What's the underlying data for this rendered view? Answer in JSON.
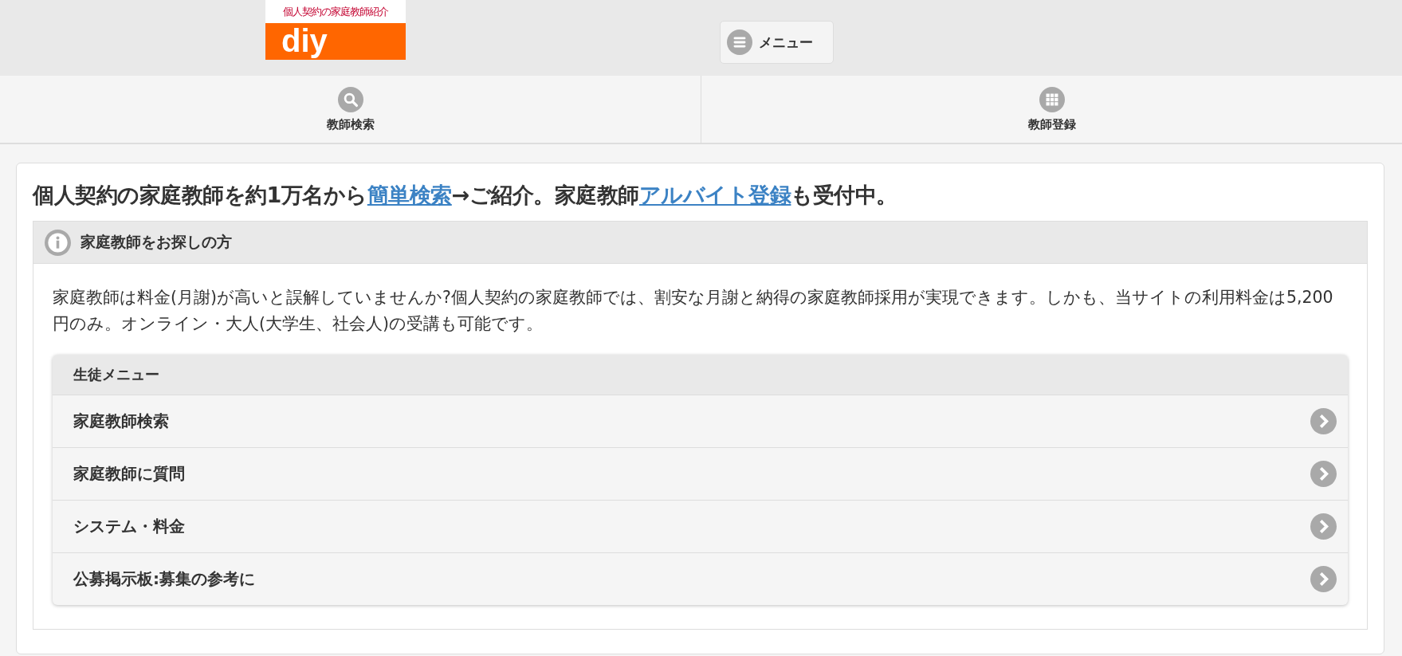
{
  "header": {
    "logo": {
      "caption": "個人契約の家庭教師紹介",
      "wordmark": "diy"
    },
    "menu_button": "メニュー"
  },
  "nav": [
    {
      "label": "教師検索"
    },
    {
      "label": "教師登録"
    }
  ],
  "headline": [
    {
      "text": "個人契約の家庭教師を約1万名から",
      "kind": "text"
    },
    {
      "text": "簡単検索",
      "kind": "link"
    },
    {
      "text": "→ご紹介。家庭教師",
      "kind": "text"
    },
    {
      "text": "アルバイト登録",
      "kind": "link"
    },
    {
      "text": "も受付中。",
      "kind": "text"
    }
  ],
  "section": {
    "title": "家庭教師をお探しの方",
    "body": "家庭教師は料金(月謝)が高いと誤解していませんか?個人契約の家庭教師では、割安な月謝と納得の家庭教師採用が実現できます。しかも、当サイトの利用料金は5,200円のみ。オンライン・大人(大学生、社会人)の受講も可能です。",
    "menu": {
      "title": "生徒メニュー",
      "items": [
        "家庭教師検索",
        "家庭教師に質問",
        "システム・料金",
        "公募掲示板:募集の参考に"
      ]
    }
  }
}
